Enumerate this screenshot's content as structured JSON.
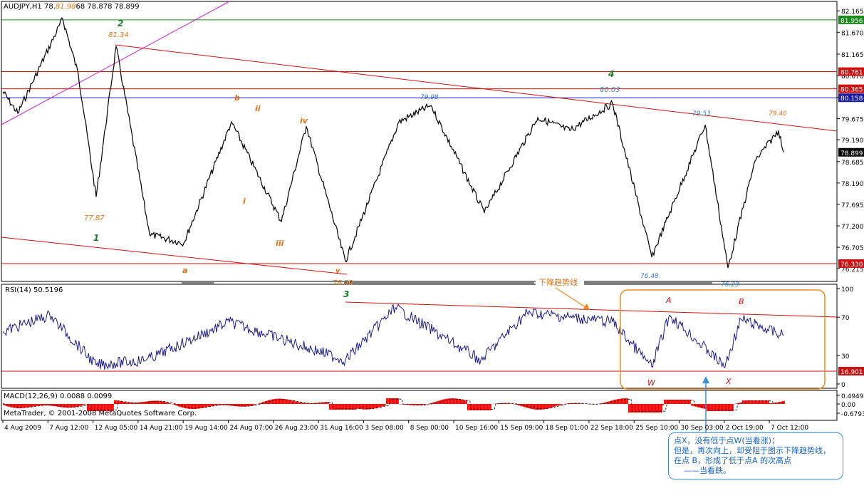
{
  "window": {
    "symbol_label": "AUDJPY,H1",
    "ohlc_label_parts": [
      "78.",
      "81.98",
      "68 78.878 78.899"
    ],
    "copyright": "MetaTrader, © 2001-2008 MetaQuotes Software Corp."
  },
  "colors": {
    "price_line": "#000000",
    "resistance_red": "#cc1111",
    "green_line": "#1a8a1a",
    "blue_line": "#1a1aa8",
    "magenta_line": "#cc22cc",
    "wave_orange": "#e07010",
    "wave_green": "#1a7a2a",
    "label_blue": "#3a7fc1",
    "rsi_line": "#1a1a8a",
    "macd_hist": "#ff0000",
    "box_orange": "#f08a1e",
    "note_blue": "#3b8fdc"
  },
  "price_axis": {
    "ticks": [
      "82.165",
      "81.670",
      "81.165",
      "80.670",
      "80.165",
      "79.675",
      "79.190",
      "78.685",
      "78.190",
      "77.695",
      "77.200",
      "76.705",
      "76.215"
    ],
    "price_tags": [
      {
        "text": "81.956",
        "value": 81.956,
        "bg": "#1a8a1a"
      },
      {
        "text": "80.761",
        "value": 80.761,
        "bg": "#cc1111"
      },
      {
        "text": "80.365",
        "value": 80.365,
        "bg": "#cc1111"
      },
      {
        "text": "80.158",
        "value": 80.158,
        "bg": "#1a1aa8"
      },
      {
        "text": "78.899",
        "value": 78.899,
        "bg": "#000000"
      },
      {
        "text": "76.330",
        "value": 76.33,
        "bg": "#cc1111"
      }
    ]
  },
  "time_axis": {
    "labels": [
      "4 Aug 2009",
      "7 Aug 12:00",
      "12 Aug 05:00",
      "14 Aug 21:00",
      "19 Aug 14:00",
      "24 Aug 07:00",
      "26 Aug 23:00",
      "31 Aug 16:00",
      "3 Sep 08:00",
      "8 Sep 00:00",
      "10 Sep 16:00",
      "15 Sep 09:00",
      "18 Sep 01:00",
      "22 Sep 18:00",
      "25 Sep 10:00",
      "30 Sep 03:00",
      "2 Oct 19:00",
      "7 Oct 12:00"
    ]
  },
  "price_annotations": [
    {
      "text": "81.98",
      "kind": "value"
    },
    {
      "text": "81.34",
      "kind": "value"
    },
    {
      "text": "77.87",
      "kind": "value"
    },
    {
      "text": "76.38",
      "kind": "value"
    },
    {
      "text": "79.98",
      "kind": "value"
    },
    {
      "text": "80.03",
      "kind": "value"
    },
    {
      "text": "79.53",
      "kind": "value"
    },
    {
      "text": "79.40",
      "kind": "value"
    },
    {
      "text": "76.48",
      "kind": "value"
    },
    {
      "text": "76.23",
      "kind": "value"
    }
  ],
  "wave_labels": {
    "primary": [
      "1",
      "2",
      "3",
      "4"
    ],
    "secondary": [
      "a",
      "b",
      "i",
      "ii",
      "iii",
      "iv",
      "v"
    ]
  },
  "downtrend_label": "下降趋势线",
  "rsi": {
    "title": "RSI(14) 50.5196",
    "ticks": [
      "100",
      "70",
      "30",
      "0"
    ],
    "level_tag": "16.901",
    "points": {
      "A": "A",
      "B": "B",
      "W": "W",
      "X": "X"
    }
  },
  "macd": {
    "title": "MACD(12,26,9) 0.0088 0.0099",
    "ticks": [
      "0.4949",
      "0.00",
      "-0.6793"
    ]
  },
  "note": {
    "lines": [
      "点X，没有低于点W(当看涨)；",
      "但是，再次向上，却受阻于图示下降趋势线，",
      "在点 B，形成了低于点A 的次高点",
      "——当看跌。"
    ]
  },
  "chart_data": [
    {
      "type": "line",
      "title": "AUDJPY,H1",
      "ylim": [
        76.0,
        82.3
      ],
      "x_start": "4 Aug 2009",
      "x_end": "7 Oct 12:00",
      "swing_points": [
        {
          "x": "4 Aug 2009",
          "y": 80.3
        },
        {
          "x": "5 Aug",
          "y": 79.8
        },
        {
          "x": "7 Aug 12:00",
          "y": 81.98
        },
        {
          "x": "10 Aug",
          "y": 80.7
        },
        {
          "x": "11 Aug",
          "y": 77.87
        },
        {
          "x": "12 Aug 05:00",
          "y": 81.34
        },
        {
          "x": "14 Aug 21:00",
          "y": 77.0
        },
        {
          "x": "19 Aug 14:00",
          "y": 76.8
        },
        {
          "x": "24 Aug 07:00",
          "y": 79.6
        },
        {
          "x": "26 Aug 23:00",
          "y": 77.3
        },
        {
          "x": "28 Aug",
          "y": 79.5
        },
        {
          "x": "31 Aug 16:00",
          "y": 76.38
        },
        {
          "x": "3 Sep 08:00",
          "y": 79.6
        },
        {
          "x": "8 Sep 00:00",
          "y": 79.98
        },
        {
          "x": "10 Sep 16:00",
          "y": 77.5
        },
        {
          "x": "15 Sep 09:00",
          "y": 79.7
        },
        {
          "x": "18 Sep 01:00",
          "y": 79.4
        },
        {
          "x": "22 Sep 18:00",
          "y": 80.03
        },
        {
          "x": "25 Sep 10:00",
          "y": 76.48
        },
        {
          "x": "30 Sep 03:00",
          "y": 79.53
        },
        {
          "x": "2 Oct 19:00",
          "y": 76.23
        },
        {
          "x": "5 Oct",
          "y": 78.7
        },
        {
          "x": "7 Oct 12:00",
          "y": 79.4
        },
        {
          "x": "7 Oct 12:00",
          "y": 78.899
        }
      ],
      "horizontal_lines": [
        81.956,
        80.761,
        80.365,
        80.158,
        76.33
      ]
    },
    {
      "type": "line",
      "title": "RSI(14) 50.5196",
      "ylim": [
        0,
        100
      ],
      "levels": [
        16.901
      ],
      "swing_points": [
        {
          "x": "4 Aug 2009",
          "y": 55
        },
        {
          "x": "7 Aug 12:00",
          "y": 72
        },
        {
          "x": "12 Aug 05:00",
          "y": 20
        },
        {
          "x": "14 Aug 21:00",
          "y": 25
        },
        {
          "x": "24 Aug 07:00",
          "y": 65
        },
        {
          "x": "31 Aug 16:00",
          "y": 25
        },
        {
          "x": "3 Sep 08:00",
          "y": 80
        },
        {
          "x": "10 Sep 16:00",
          "y": 25
        },
        {
          "x": "15 Sep 09:00",
          "y": 75
        },
        {
          "x": "22 Sep 18:00",
          "y": 65
        },
        {
          "x": "25 Sep 10:00",
          "y": 18
        },
        {
          "x": "28 Sep",
          "y": 72
        },
        {
          "x": "2 Oct 19:00",
          "y": 18
        },
        {
          "x": "5 Oct",
          "y": 68
        },
        {
          "x": "7 Oct 12:00",
          "y": 50.5
        }
      ]
    },
    {
      "type": "bar",
      "title": "MACD(12,26,9) 0.0088 0.0099",
      "ylim": [
        -0.6793,
        0.4949
      ],
      "signal_last": 0.0099,
      "main_last": 0.0088
    }
  ]
}
